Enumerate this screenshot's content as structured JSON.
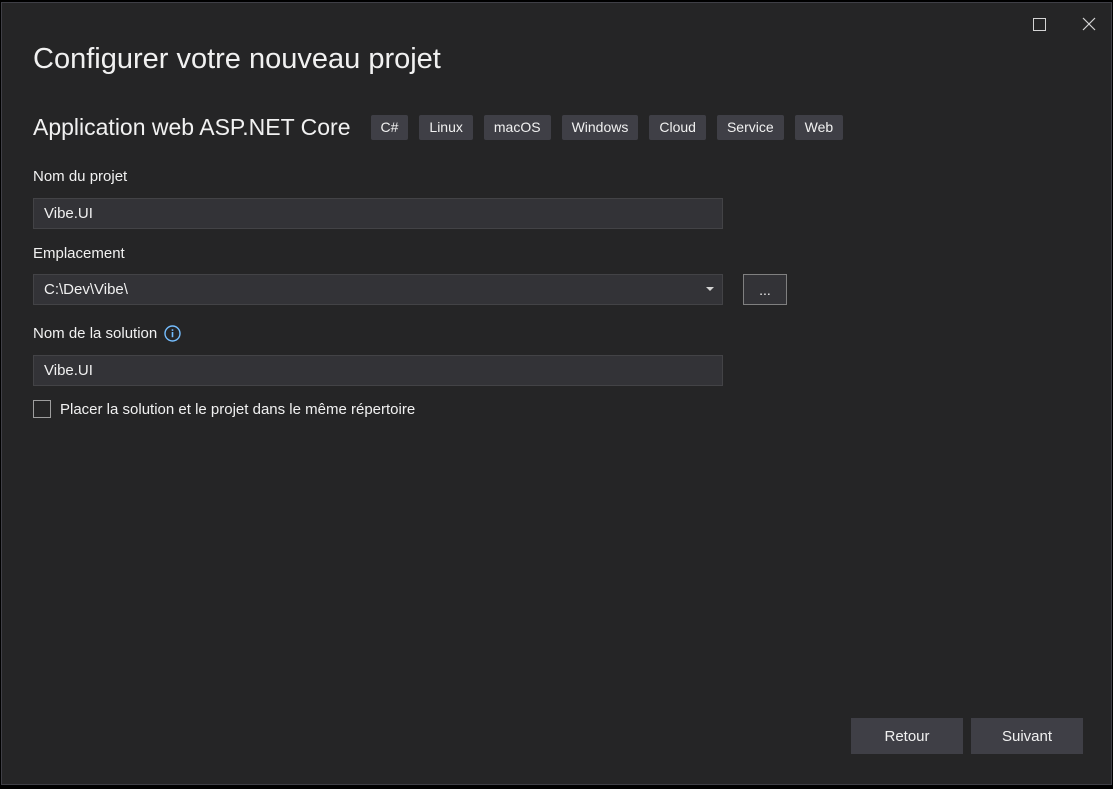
{
  "window": {
    "maximize_icon": "maximize-icon",
    "close_icon": "close-icon"
  },
  "page": {
    "title": "Configurer votre nouveau projet"
  },
  "template": {
    "name": "Application web ASP.NET Core",
    "tags": [
      "C#",
      "Linux",
      "macOS",
      "Windows",
      "Cloud",
      "Service",
      "Web"
    ]
  },
  "project_name": {
    "label": "Nom du projet",
    "value": "Vibe.UI"
  },
  "location": {
    "label": "Emplacement",
    "value": "C:\\Dev\\Vibe\\",
    "browse_label": "..."
  },
  "solution_name": {
    "label": "Nom de la solution",
    "info_icon": "info-icon",
    "value": "Vibe.UI"
  },
  "same_directory": {
    "label": "Placer la solution et le projet dans le même répertoire",
    "checked": false
  },
  "footer": {
    "back_label": "Retour",
    "next_label": "Suivant"
  },
  "colors": {
    "background": "#252526",
    "input_background": "#333337",
    "button_background": "#3f3f46",
    "text": "#f1f1f1",
    "info_accent": "#75beff"
  }
}
